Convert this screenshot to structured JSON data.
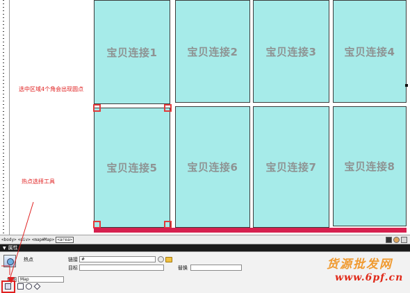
{
  "hotspots": [
    {
      "label": "宝贝连接1"
    },
    {
      "label": "宝贝连接2"
    },
    {
      "label": "宝贝连接3"
    },
    {
      "label": "宝贝连接4"
    },
    {
      "label": "宝贝连接5"
    },
    {
      "label": "宝贝连接6"
    },
    {
      "label": "宝贝连接7"
    },
    {
      "label": "宝贝连接8"
    }
  ],
  "annotations": {
    "corner_points_note": "选中区域4个角会出现圆点",
    "hotspot_tool_note": "热点选择工具"
  },
  "tag_selector": {
    "tags": [
      "<body>",
      "<div>",
      "<map#Map>",
      "<area>"
    ]
  },
  "properties": {
    "title": "属性",
    "hotspot_label": "热点",
    "link_label": "链接",
    "link_value": "#",
    "target_label": "目标",
    "target_value": "",
    "alt_label": "替换",
    "alt_value": "",
    "map_label": "地图",
    "map_value": "Map"
  },
  "watermark": {
    "line1": "货源批发网",
    "line2": "www.6pf.cn"
  },
  "colors": {
    "hotspot_fill": "#a6ebe9",
    "handle": "#e23a3a",
    "selection_bar": "#d6204e",
    "annotation_text": "#e02020"
  },
  "icons": {
    "hotspot_tool": "hotspot-tool-icon",
    "pointer_tool": "pointer-hotspot-icon",
    "rect_tool": "rectangle-hotspot-icon",
    "circle_tool": "circle-hotspot-icon",
    "polygon_tool": "polygon-hotspot-icon",
    "point_to_file": "point-to-file-icon",
    "browse_folder": "folder-icon"
  }
}
